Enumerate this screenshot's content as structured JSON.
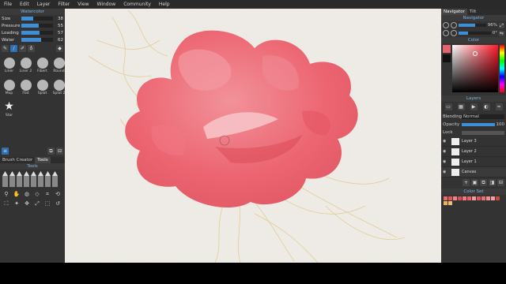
{
  "menu": [
    "File",
    "Edit",
    "Layer",
    "Filter",
    "View",
    "Window",
    "Community",
    "Help"
  ],
  "left": {
    "panel_title": "Watercolor",
    "params": [
      {
        "label": "Size",
        "value": "38",
        "fill": 0.38
      },
      {
        "label": "Pressure",
        "value": "55",
        "fill": 0.55
      },
      {
        "label": "Loading",
        "value": "57",
        "fill": 0.57
      },
      {
        "label": "Water",
        "value": "62",
        "fill": 0.62
      }
    ],
    "brushes": [
      "Liner",
      "Liner 2",
      "Fibert",
      "Round",
      "Mop",
      "Flat",
      "Splat",
      "Splat 2",
      "Star"
    ],
    "tabs": [
      "Brush Creator",
      "Tools"
    ],
    "tools_title": "Tools"
  },
  "right": {
    "tabs": [
      "Navigator",
      "Tilt"
    ],
    "navigator_title": "Navigator",
    "zoom": "96%",
    "rotation": "0°",
    "color_title": "Color",
    "layers_title": "Layers",
    "blending_label": "Blending",
    "blending_value": "Normal",
    "opacity_label": "Opacity",
    "opacity_value": "100",
    "lock_label": "Lock",
    "layers": [
      "Layer 3",
      "Layer 2",
      "Layer 1",
      "Canvas"
    ],
    "colorset_title": "Color Set",
    "accent": "#3f8fd6",
    "swatch_colors": [
      "#e86a6e",
      "#e4555c",
      "#ef8587",
      "#d94a52",
      "#f07d7a",
      "#e96264",
      "#f29b98",
      "#d8585c",
      "#e57274",
      "#ef9090",
      "#f0a0a0",
      "#c8473e",
      "#e8b45a",
      "#efc06a"
    ]
  }
}
